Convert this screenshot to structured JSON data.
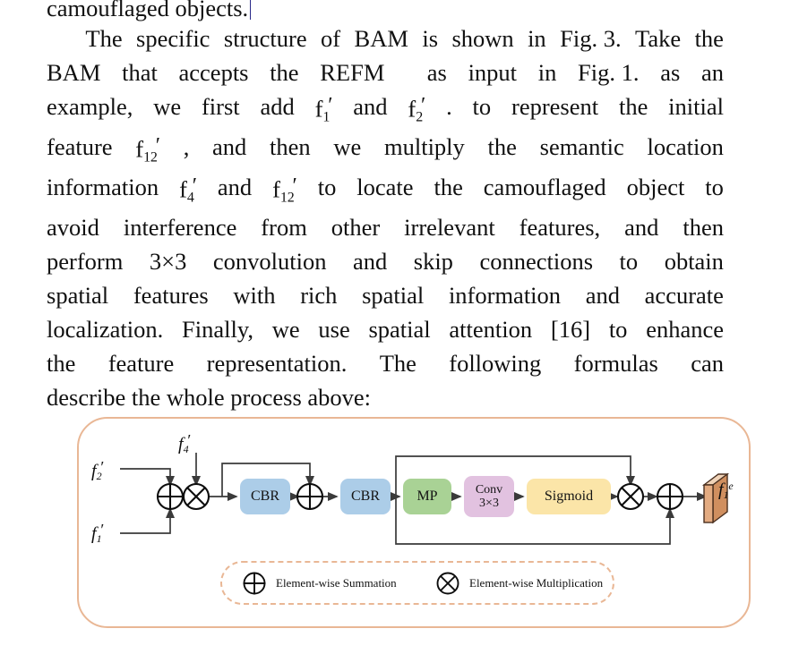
{
  "document": {
    "paragraph_lines": [
      {
        "type": "plain",
        "text": "camouflaged objects.",
        "caret": true
      },
      {
        "type": "justified",
        "indent": true,
        "words": [
          "The",
          "specific",
          "structure",
          "of",
          "BAM",
          "is",
          "shown",
          "in",
          "Fig. 3.",
          "Take",
          "the"
        ]
      },
      {
        "type": "justified",
        "words": [
          "BAM",
          "that",
          "accepts",
          "the",
          "REFM",
          "",
          "as",
          "input",
          "in",
          "Fig. 1.",
          "as",
          "an"
        ]
      },
      {
        "type": "math-line-1",
        "prefix_words": [
          "example,",
          "we",
          "first",
          "add"
        ],
        "math1": {
          "base": "f",
          "prime": "′",
          "sub": "1"
        },
        "mid_word": "and",
        "math2": {
          "base": "f",
          "prime": "′",
          "sub": "2"
        },
        "suffix_words": [
          ".",
          "to",
          "represent",
          "the",
          "initial"
        ]
      },
      {
        "type": "math-line-2",
        "prefix_words": [
          "feature"
        ],
        "math1": {
          "base": "f",
          "prime": "′",
          "sub": "12"
        },
        "suffix_words": [
          ",",
          "and",
          "then",
          "we",
          "multiply",
          "the",
          "semantic",
          "location"
        ]
      },
      {
        "type": "math-line-3",
        "prefix_words": [
          "information"
        ],
        "math1": {
          "base": "f",
          "prime": "′",
          "sub": "4"
        },
        "mid_word": "and",
        "math2": {
          "base": "f",
          "prime": "′",
          "sub": "12"
        },
        "suffix_words": [
          "to",
          "locate",
          "the",
          "camouflaged",
          "object",
          "to"
        ]
      },
      {
        "type": "justified",
        "words": [
          "avoid",
          "interference",
          "from",
          "other",
          "irrelevant",
          "features,",
          "and",
          "then"
        ]
      },
      {
        "type": "justified",
        "words": [
          "perform",
          "3×3",
          "convolution",
          "and",
          "skip",
          "connections",
          "to",
          "obtain"
        ]
      },
      {
        "type": "justified",
        "words": [
          "spatial",
          "features",
          "with",
          "rich",
          "spatial",
          "information",
          "and",
          "accurate"
        ]
      },
      {
        "type": "justified",
        "words": [
          "localization.",
          "Finally,",
          "we",
          "use",
          "spatial",
          "attention",
          "[16]",
          "to",
          "enhance"
        ]
      },
      {
        "type": "justified",
        "words": [
          "the",
          "feature",
          "representation.",
          "The",
          "following",
          "formulas",
          "can"
        ]
      },
      {
        "type": "plain",
        "text": "describe the whole process above:",
        "caret": false
      }
    ]
  },
  "figure": {
    "inputs": {
      "f2": {
        "base": "f",
        "prime": "′",
        "sub": "2"
      },
      "f1": {
        "base": "f",
        "prime": "′",
        "sub": "1"
      },
      "f4": {
        "base": "f",
        "prime": "′",
        "sub": "4"
      }
    },
    "output": {
      "base": "f",
      "sub": "1",
      "sup": "e"
    },
    "nodes": [
      {
        "id": "cbr1",
        "label": "CBR",
        "color": "#accde8"
      },
      {
        "id": "cbr2",
        "label": "CBR",
        "color": "#accde8"
      },
      {
        "id": "mp",
        "label": "MP",
        "color": "#a9d295"
      },
      {
        "id": "conv",
        "label_line1": "Conv",
        "label_line2": "3×3",
        "color": "#e2c2e0"
      },
      {
        "id": "sigmoid",
        "label": "Sigmoid",
        "color": "#fbe5a8"
      }
    ],
    "operators": [
      {
        "id": "sum-1",
        "symbol": "⊕"
      },
      {
        "id": "mul-1",
        "symbol": "⊗"
      },
      {
        "id": "sum-2",
        "symbol": "⊕"
      },
      {
        "id": "mul-2",
        "symbol": "⊗"
      },
      {
        "id": "sum-3",
        "symbol": "⊕"
      }
    ],
    "legend": {
      "summation_label": "Element-wise Summation",
      "multiplication_label": "Element-wise Multiplication",
      "summation_symbol": "⊕",
      "multiplication_symbol": "⊗"
    },
    "colors": {
      "panel_border": "#e9b795",
      "legend_border": "#e9b795",
      "wire": "#3a3a3a",
      "output_front": "#e3ab81",
      "output_top": "#f0d3b8",
      "output_side": "#d08f5f"
    }
  }
}
